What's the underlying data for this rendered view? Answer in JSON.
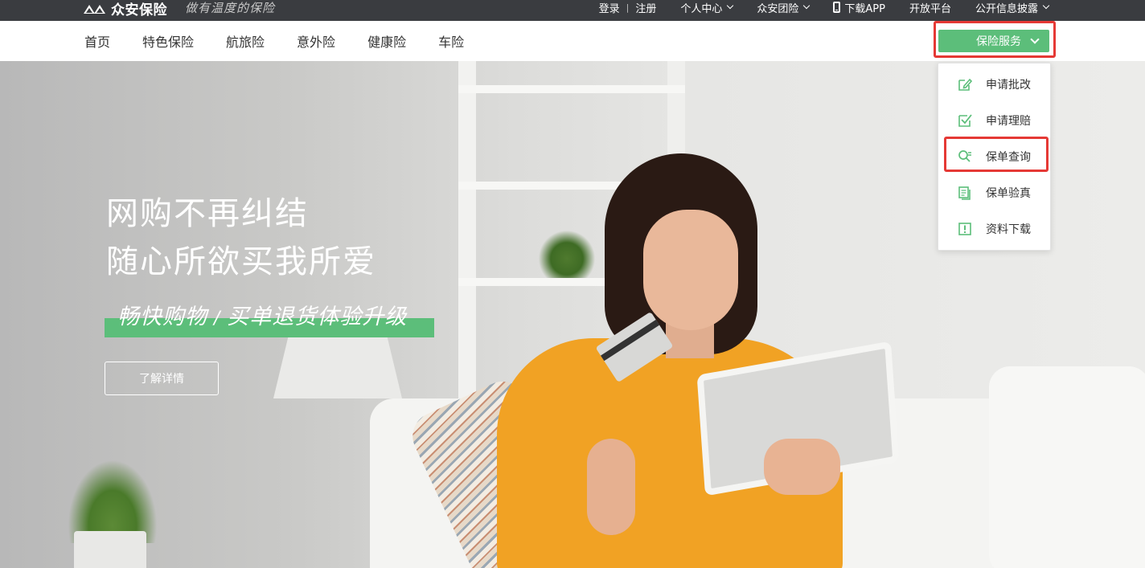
{
  "topbar": {
    "logo_text": "众安保险",
    "slogan": "做有温度的保险",
    "login": "登录",
    "register": "注册",
    "personal_center": "个人中心",
    "group_insurance": "众安团险",
    "download_app": "下载APP",
    "open_platform": "开放平台",
    "disclosure": "公开信息披露"
  },
  "mainnav": {
    "items": [
      {
        "label": "首页"
      },
      {
        "label": "特色保险"
      },
      {
        "label": "航旅险"
      },
      {
        "label": "意外险"
      },
      {
        "label": "健康险"
      },
      {
        "label": "车险"
      }
    ],
    "service_button": "保险服务"
  },
  "hero": {
    "title_line1": "网购不再纠结",
    "title_line2": "随心所欲买我所爱",
    "sub_left": "畅快购物",
    "sub_right": "买单退货体验升级",
    "cta": "了解详情"
  },
  "dropdown": {
    "items": [
      {
        "label": "申请批改",
        "icon": "edit-icon"
      },
      {
        "label": "申请理赔",
        "icon": "check-box-icon"
      },
      {
        "label": "保单查询",
        "icon": "search-policy-icon"
      },
      {
        "label": "保单验真",
        "icon": "verify-doc-icon"
      },
      {
        "label": "资料下载",
        "icon": "download-icon"
      }
    ]
  },
  "colors": {
    "accent_green": "#5cbe7a",
    "topbar_bg": "#3a3c40",
    "highlight_red": "#e53935"
  }
}
